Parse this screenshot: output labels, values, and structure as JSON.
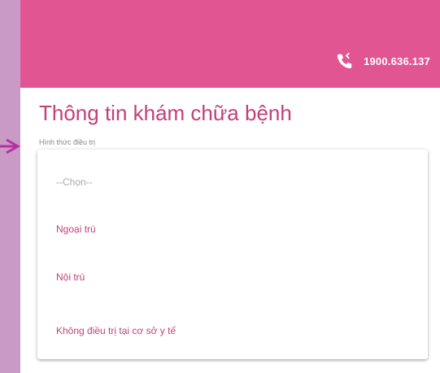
{
  "header": {
    "phone_icon": "phone-icon",
    "phone_number": "1900.636.137",
    "background_color": "#e05592"
  },
  "form": {
    "title": "Thông tin khám chữa bệnh",
    "treatment_field": {
      "label": "Hình thức điều trị",
      "options": [
        "--Chọn--",
        "Ngoại trú",
        "Nội trú",
        "Không điều trị tại cơ sở y tế"
      ]
    }
  },
  "colors": {
    "accent": "#c2407a",
    "backdrop": "#c99ac6",
    "arrow": "#b4329f"
  }
}
